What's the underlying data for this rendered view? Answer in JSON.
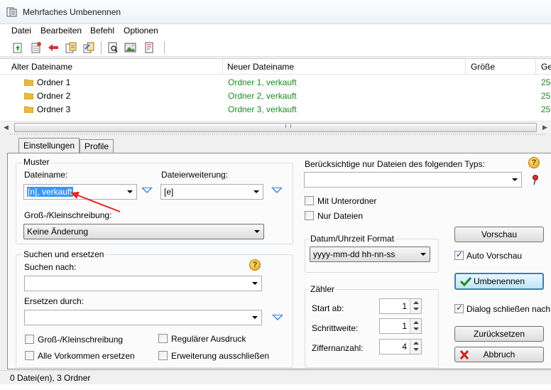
{
  "window": {
    "title": "Mehrfaches Umbenennen"
  },
  "menu": {
    "items": [
      "Datei",
      "Bearbeiten",
      "Befehl",
      "Optionen"
    ]
  },
  "toolbar": {
    "icons": [
      "add-files-icon",
      "add-folder-icon",
      "remove-icon",
      "rename-icon",
      "undo-rename-icon",
      "preview-icon",
      "image-icon",
      "info-icon"
    ]
  },
  "filelist": {
    "columns": [
      "Alter Dateiname",
      "Neuer Dateiname",
      "Größe",
      "Ge"
    ],
    "rows": [
      {
        "old": "Ordner 1",
        "new": "Ordner 1, verkauft",
        "date": "25."
      },
      {
        "old": "Ordner 2",
        "new": "Ordner 2, verkauft",
        "date": "25."
      },
      {
        "old": "Ordner 3",
        "new": "Ordner 3, verkauft",
        "date": "25."
      }
    ]
  },
  "tabs": {
    "settings": "Einstellungen",
    "profile": "Profile"
  },
  "pattern": {
    "group_label": "Muster",
    "filename_label": "Dateiname:",
    "filename_value": "[n], verkauft",
    "extension_label": "Dateierweiterung:",
    "extension_value": "[e]",
    "case_label": "Groß-/Kleinschreibung:",
    "case_value": "Keine Änderung"
  },
  "search": {
    "group_label": "Suchen und ersetzen",
    "search_label": "Suchen nach:",
    "search_value": "",
    "replace_label": "Ersetzen durch:",
    "replace_value": "",
    "opt_case": "Groß-/Kleinschreibung",
    "opt_regex": "Regulärer Ausdruck",
    "opt_all": "Alle Vorkommen ersetzen",
    "opt_excl_ext": "Erweiterung ausschließen"
  },
  "filter": {
    "label": "Berücksichtige nur Dateien des folgenden Typs:",
    "value": "",
    "with_subfolders": "Mit Unterordner",
    "only_files": "Nur Dateien"
  },
  "datetime": {
    "group_label": "Datum/Uhrzeit Format",
    "value": "yyyy-mm-dd hh-nn-ss"
  },
  "counter": {
    "group_label": "Zähler",
    "start_label": "Start ab:",
    "start_value": "1",
    "step_label": "Schrittweite:",
    "step_value": "1",
    "digits_label": "Ziffernanzahl:",
    "digits_value": "4"
  },
  "actions": {
    "preview": "Vorschau",
    "auto_preview": "Auto Vorschau",
    "rename": "Umbenennen",
    "close_dialog": "Dialog schließen nach",
    "reset": "Zurücksetzen",
    "cancel": "Abbruch"
  },
  "status": {
    "text": "0 Datei(en), 3 Ordner"
  },
  "colors": {
    "new_name": "#1d8a1d",
    "accent_triangle": "#3a82d6",
    "annotation_arrow": "#e8262a"
  }
}
